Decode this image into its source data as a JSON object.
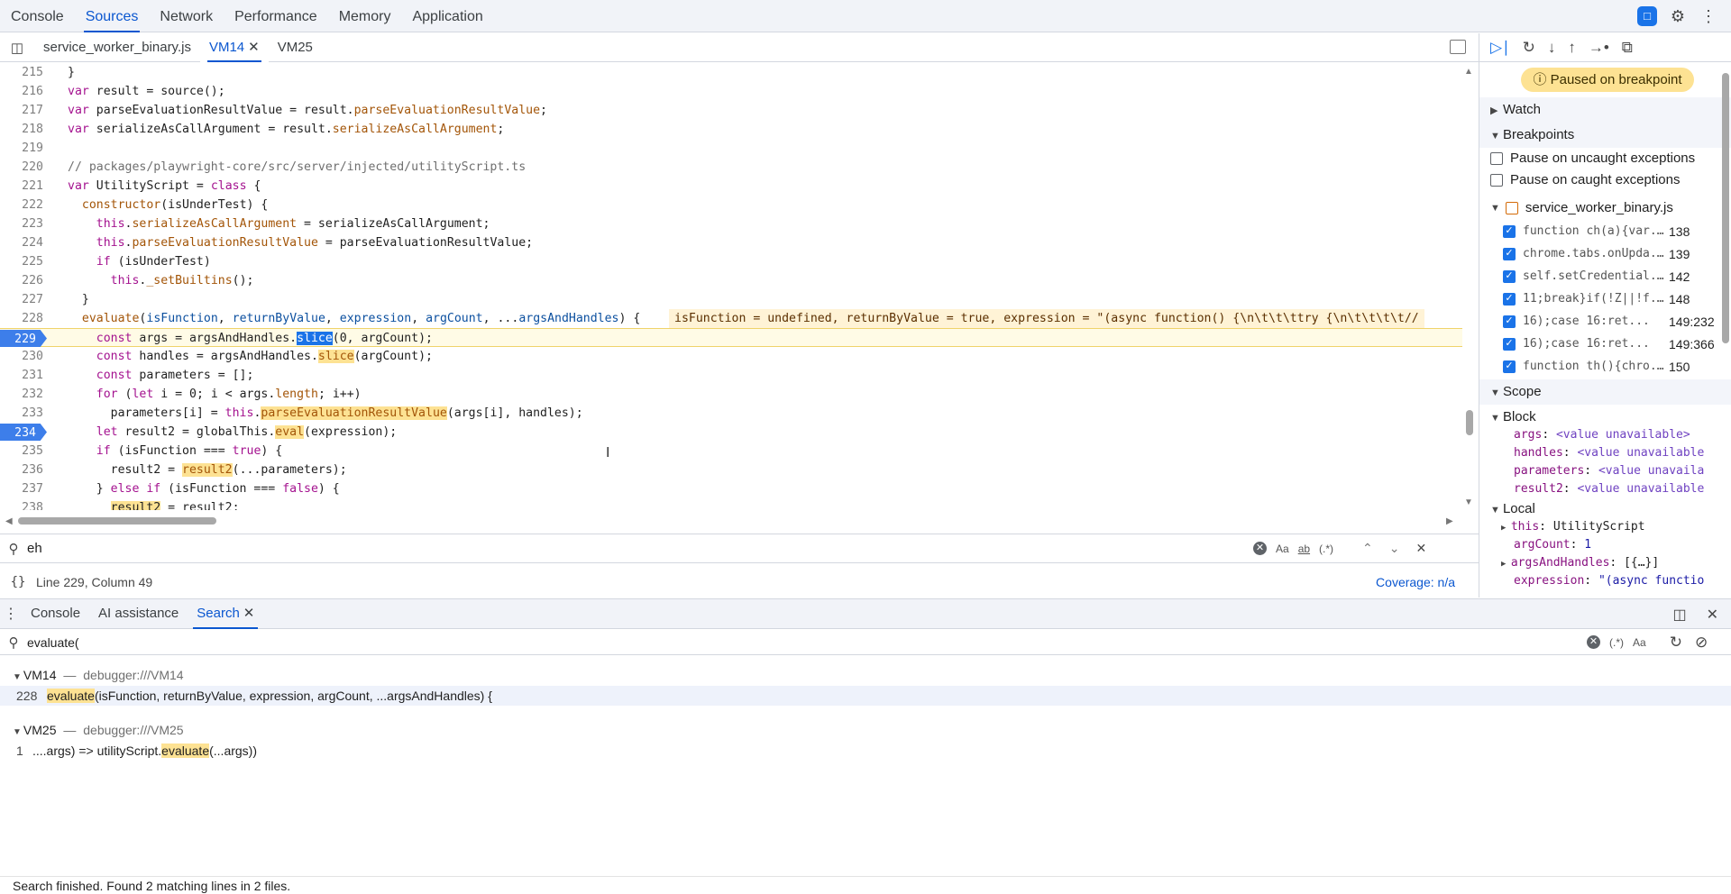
{
  "top_tabs": [
    "Console",
    "Sources",
    "Network",
    "Performance",
    "Memory",
    "Application"
  ],
  "active_top_tab": "Sources",
  "file_tabs": [
    {
      "label": "service_worker_binary.js"
    },
    {
      "label": "VM14"
    },
    {
      "label": "VM25"
    }
  ],
  "editor": {
    "lines": [
      {
        "n": "215",
        "code": "}"
      },
      {
        "n": "216",
        "code": "var result = source();"
      },
      {
        "n": "217",
        "code": "var parseEvaluationResultValue = result.parseEvaluationResultValue;"
      },
      {
        "n": "218",
        "code": "var serializeAsCallArgument = result.serializeAsCallArgument;"
      },
      {
        "n": "219",
        "code": ""
      },
      {
        "n": "220",
        "code": "// packages/playwright-core/src/server/injected/utilityScript.ts"
      },
      {
        "n": "221",
        "code": "var UtilityScript = class {"
      },
      {
        "n": "222",
        "code": "  constructor(isUnderTest) {"
      },
      {
        "n": "223",
        "code": "    this.serializeAsCallArgument = serializeAsCallArgument;"
      },
      {
        "n": "224",
        "code": "    this.parseEvaluationResultValue = parseEvaluationResultValue;"
      },
      {
        "n": "225",
        "code": "    if (isUnderTest)"
      },
      {
        "n": "226",
        "code": "      this._setBuiltins();"
      },
      {
        "n": "227",
        "code": "  }"
      },
      {
        "n": "228",
        "code": "  evaluate(isFunction, returnByValue, expression, argCount, ...argsAndHandles) {"
      },
      {
        "n": "229",
        "code": "    const args = argsAndHandles.slice(0, argCount);"
      },
      {
        "n": "230",
        "code": "    const handles = argsAndHandles.slice(argCount);"
      },
      {
        "n": "231",
        "code": "    const parameters = [];"
      },
      {
        "n": "232",
        "code": "    for (let i = 0; i < args.length; i++)"
      },
      {
        "n": "233",
        "code": "      parameters[i] = this.parseEvaluationResultValue(args[i], handles);"
      },
      {
        "n": "234",
        "code": "    let result2 = globalThis.eval(expression);"
      },
      {
        "n": "235",
        "code": "    if (isFunction === true) {"
      },
      {
        "n": "236",
        "code": "      result2 = result2(...parameters);"
      },
      {
        "n": "237",
        "code": "    } else if (isFunction === false) {"
      },
      {
        "n": "238",
        "code": "      result2 = result2;"
      }
    ],
    "inline_values": "isFunction = undefined, returnByValue = true, expression = \"(async function() {\\n\\t\\t\\ttry {\\n\\t\\t\\t\\t//",
    "breakpoint_lines": [
      "229",
      "234"
    ]
  },
  "find": {
    "value": "eh",
    "options": [
      "Aa",
      "ab",
      "(.*)"
    ]
  },
  "status": {
    "position": "Line 229, Column 49",
    "coverage": "Coverage: n/a"
  },
  "debugger": {
    "paused_label": "Paused on breakpoint",
    "sections": {
      "watch": "Watch",
      "breakpoints": "Breakpoints",
      "scope": "Scope"
    },
    "pause_uncaught": "Pause on uncaught exceptions",
    "pause_caught": "Pause on caught exceptions",
    "bp_file": "service_worker_binary.js",
    "breakpoints": [
      {
        "text": "function ch(a){var...",
        "line": "138"
      },
      {
        "text": "chrome.tabs.onUpda...",
        "line": "139"
      },
      {
        "text": "self.setCredential...",
        "line": "142"
      },
      {
        "text": "11;break}if(!Z||!f...",
        "line": "148"
      },
      {
        "text": "16);case 16:ret...",
        "line": "149:232"
      },
      {
        "text": "16);case 16:ret...",
        "line": "149:366"
      },
      {
        "text": "function th(){chro...",
        "line": "150"
      }
    ],
    "scope": {
      "block_label": "Block",
      "block_vars": [
        {
          "k": "args",
          "v": "<value unavailable>"
        },
        {
          "k": "handles",
          "v": "<value unavailable"
        },
        {
          "k": "parameters",
          "v": "<value unavaila"
        },
        {
          "k": "result2",
          "v": "<value unavailable"
        }
      ],
      "local_label": "Local",
      "local_vars": [
        {
          "k": "this",
          "v": "UtilityScript",
          "expandable": true
        },
        {
          "k": "argCount",
          "v": "1",
          "expandable": false
        },
        {
          "k": "argsAndHandles",
          "v": "[{…}]",
          "expandable": true
        },
        {
          "k": "expression",
          "v": "\"(async functio",
          "expandable": false
        }
      ]
    }
  },
  "drawer": {
    "tabs": [
      "Console",
      "AI assistance",
      "Search"
    ],
    "active_tab": "Search",
    "search_value": "evaluate(",
    "search_options": [
      "(.*)",
      "Aa"
    ],
    "results": [
      {
        "file": "VM14",
        "path": "debugger:///VM14",
        "matches": [
          {
            "line": "228",
            "before": "",
            "match": "evaluate",
            "after": "(isFunction, returnByValue, expression, argCount, ...argsAndHandles) {"
          }
        ]
      },
      {
        "file": "VM25",
        "path": "debugger:///VM25",
        "matches": [
          {
            "line": "1",
            "before": "....args) => utilityScript.",
            "match": "evaluate",
            "after": "(...args))"
          }
        ]
      }
    ],
    "footer": "Search finished.  Found 2 matching lines in 2 files."
  },
  "colors": {
    "accent": "#0b57d0",
    "breakpoint": "#3d7eea",
    "paused_bg": "#fde293"
  }
}
